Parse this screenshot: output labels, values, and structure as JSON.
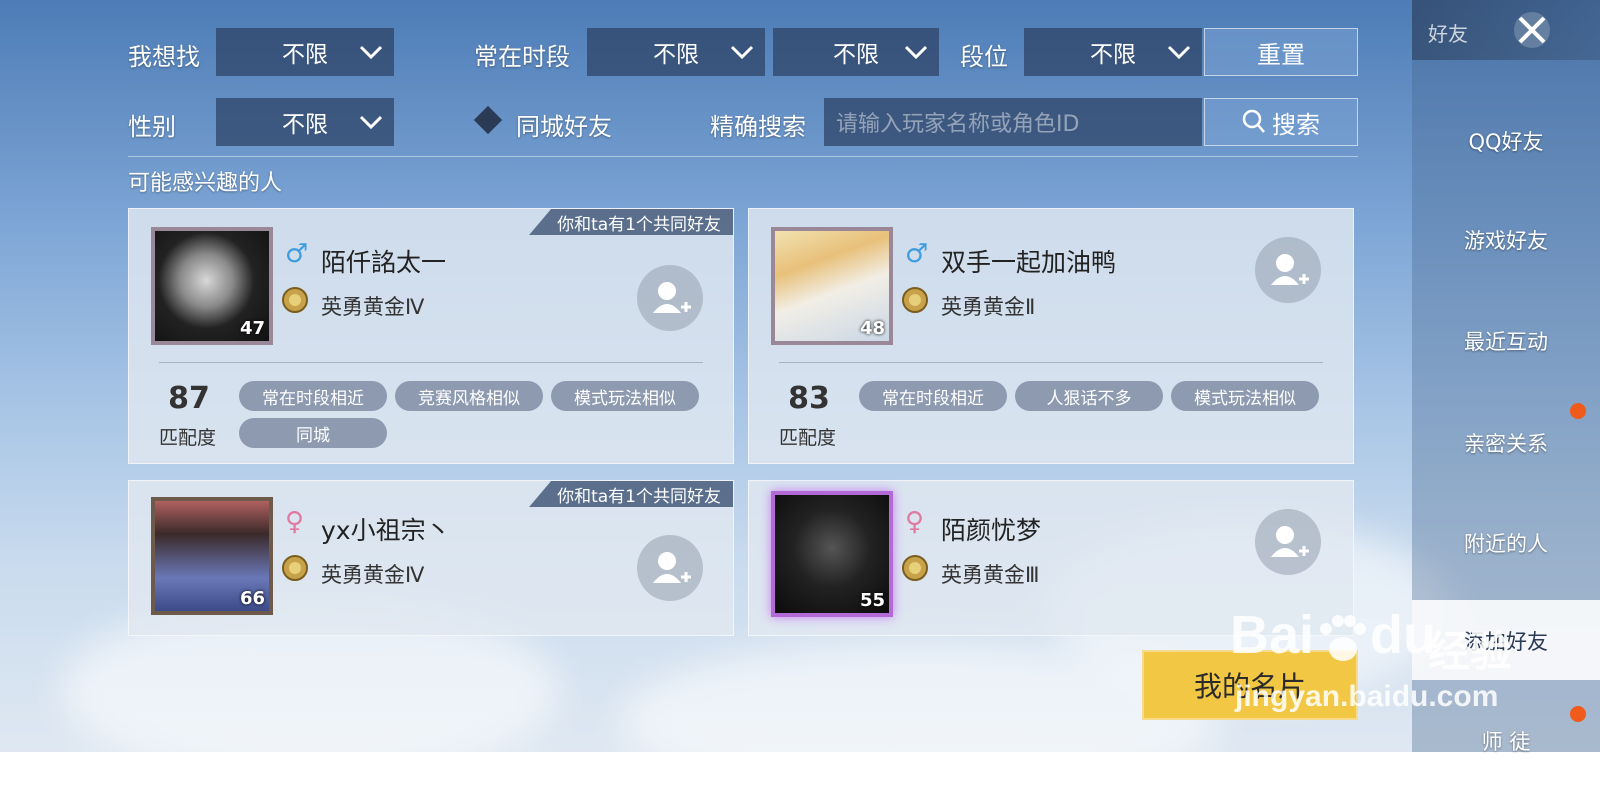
{
  "filters": {
    "want_label": "我想找",
    "want_value": "不限",
    "time_label": "常在时段",
    "time_value1": "不限",
    "time_value2": "不限",
    "rank_label": "段位",
    "rank_value": "不限",
    "reset_label": "重置",
    "gender_label": "性别",
    "gender_value": "不限",
    "samecity_label": "同城好友",
    "search_label": "精确搜索",
    "search_placeholder": "请输入玩家名称或角色ID",
    "search_button": "搜索"
  },
  "section_title": "可能感兴趣的人",
  "cards": [
    {
      "banner": "你和ta有1个共同好友",
      "gender_symbol": "♂",
      "name": "陌仟詺太一",
      "rank": "英勇黄金Ⅳ",
      "medal_level": "IV",
      "level": "47",
      "score": "87",
      "score_label": "匹配度",
      "tags": [
        "常在时段相近",
        "竞赛风格相似",
        "模式玩法相似",
        "同城"
      ]
    },
    {
      "banner": "",
      "gender_symbol": "♂",
      "name": "双手一起加油鸭",
      "rank": "英勇黄金Ⅱ",
      "medal_level": "II",
      "level": "48",
      "score": "83",
      "score_label": "匹配度",
      "tags": [
        "常在时段相近",
        "人狠话不多",
        "模式玩法相似"
      ]
    },
    {
      "banner": "你和ta有1个共同好友",
      "gender_symbol": "♀",
      "name": "yx小祖宗丶",
      "rank": "英勇黄金Ⅳ",
      "medal_level": "IV",
      "level": "66"
    },
    {
      "banner": "",
      "gender_symbol": "♀",
      "name": "陌颜忧梦",
      "rank": "英勇黄金Ⅲ",
      "medal_level": "III",
      "level": "55"
    }
  ],
  "my_card_button": "我的名片",
  "sidebar": {
    "header": "好友",
    "items": [
      "QQ好友",
      "游戏好友",
      "最近互动",
      "亲密关系",
      "附近的人",
      "添加好友",
      "师 徒"
    ]
  },
  "watermark": {
    "brand": "Bai",
    "brand2": "du",
    "cn": "经验",
    "url": "jingyan.baidu.com"
  },
  "colors": {
    "male": "#3e9ce0",
    "female": "#e07aa0",
    "my_card": "#f2c744",
    "notify": "#f05a1a"
  }
}
